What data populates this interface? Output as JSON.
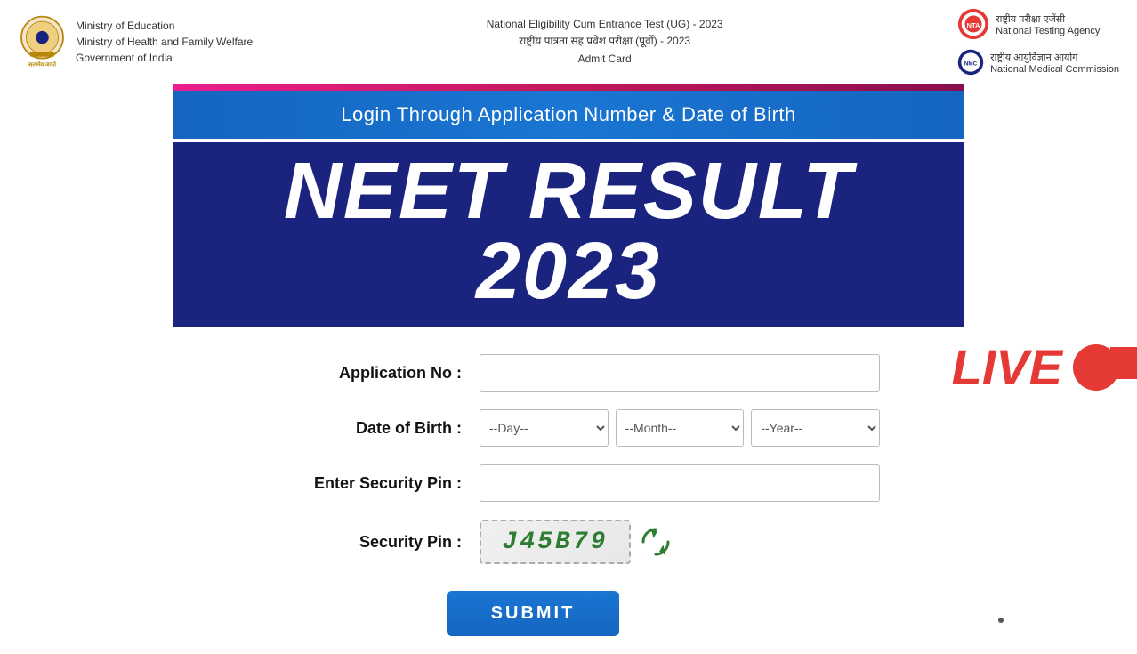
{
  "header": {
    "left": {
      "line1": "Ministry of Education",
      "line2": "Ministry of Health and Family Welfare",
      "line3": "Government of India"
    },
    "center": {
      "line1": "National Eligibility Cum Entrance Test (UG) - 2023",
      "line2": "राष्ट्रीय पात्रता सह प्रवेश परीक्षा (पूर्वी) - 2023",
      "line3": "Admit Card"
    },
    "right": {
      "nta_label": "National Testing Agency",
      "nmc_label": "National Medical Commission",
      "nta_hindi": "राष्ट्रीय परीक्षा एजेंसी",
      "nmc_hindi": "राष्ट्रीय आयुर्विज्ञान आयोग"
    }
  },
  "login_banner": {
    "text": "Login Through Application Number & Date of Birth"
  },
  "neet_banner": {
    "title": "NEET Result 2023"
  },
  "form": {
    "application_label": "Application No :",
    "application_placeholder": "",
    "dob_label": "Date of Birth :",
    "dob_day_default": "--Day--",
    "dob_month_default": "--Month--",
    "dob_year_default": "--Year--",
    "security_pin_label": "Enter Security Pin :",
    "security_pin_placeholder": "",
    "security_pin_display_label": "Security Pin :",
    "security_pin_value": "J45B79",
    "submit_label": "SUBMIT"
  },
  "live": {
    "text": "LIVE"
  }
}
